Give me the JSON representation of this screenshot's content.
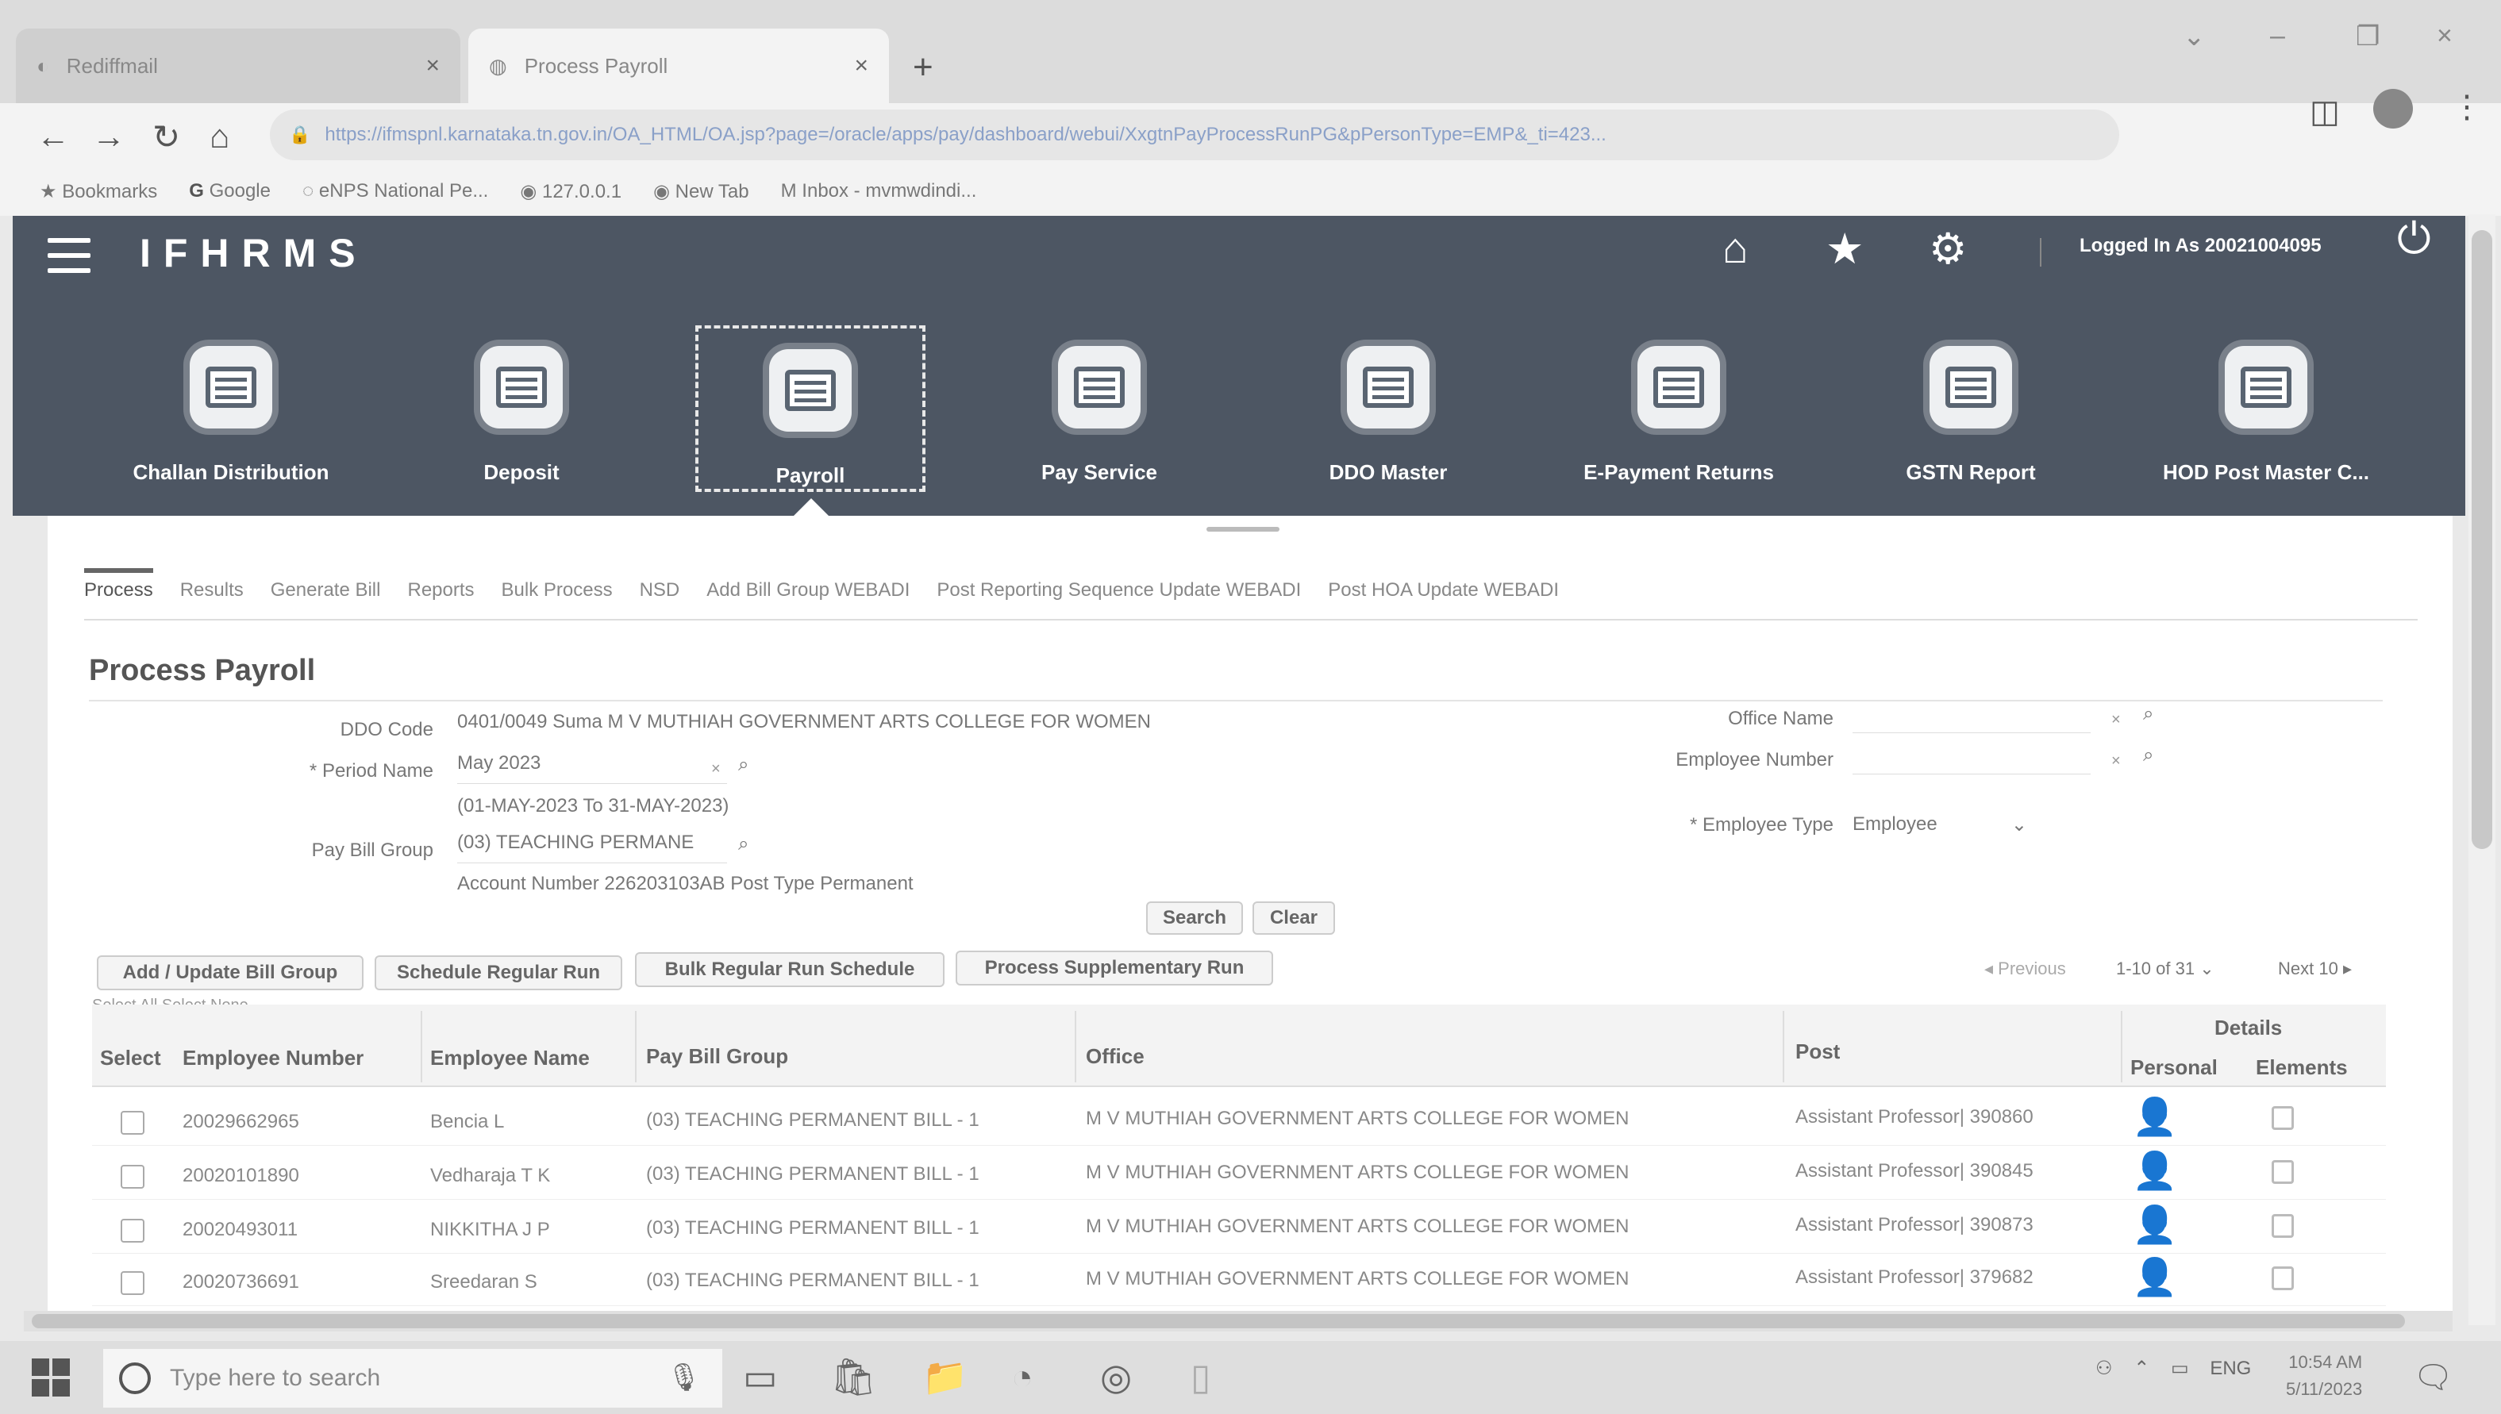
{
  "browser": {
    "tabs": [
      {
        "title": "Rediffmail",
        "active": false
      },
      {
        "title": "Process Payroll",
        "active": true
      }
    ],
    "new_tab_symbol": "+",
    "url": "https://ifmspnl.karnataka.tn.gov.in/OA_HTML/OA.jsp?page=/oracle/apps/pay/dashboard/webui/XxgtnPayProcessRunPG&pPersonType=EMP&_ti=423...",
    "bookmarks": [
      "Bookmarks",
      "Google",
      "eNPS  National Pe...",
      "127.0.0.1",
      "New Tab",
      "Inbox - mvmwdindi..."
    ]
  },
  "app": {
    "logo": "IFHRMS",
    "logged_in": "Logged In As 20021004095",
    "tiles": [
      {
        "label": "Challan Distribution",
        "active": false
      },
      {
        "label": "Deposit",
        "active": false
      },
      {
        "label": "Payroll",
        "active": true
      },
      {
        "label": "Pay Service",
        "active": false
      },
      {
        "label": "DDO Master",
        "active": false
      },
      {
        "label": "E-Payment Returns",
        "active": false
      },
      {
        "label": "GSTN Report",
        "active": false
      },
      {
        "label": "HOD Post Master C...",
        "active": false
      }
    ],
    "subtabs": [
      "Process",
      "Results",
      "Generate Bill",
      "Reports",
      "Bulk Process",
      "NSD",
      "Add Bill Group WEBADI",
      "Post Reporting Sequence Update WEBADI",
      "Post HOA Update WEBADI"
    ]
  },
  "form": {
    "title": "Process Payroll",
    "ddo_code_label": "DDO Code",
    "ddo_code_value": "0401/0049 Suma M V MUTHIAH GOVERNMENT ARTS COLLEGE FOR WOMEN",
    "period_label": "Period Name",
    "period_value": "May 2023",
    "period_range": "(01-MAY-2023 To 31-MAY-2023)",
    "paybill_label": "Pay Bill Group",
    "paybill_value": "(03) TEACHING PERMANE",
    "account_line": "Account Number  226203103AB  Post Type  Permanent",
    "office_label": "Office Name",
    "employee_number_label": "Employee Number",
    "employee_type_label": "Employee Type",
    "employee_type_value": "Employee",
    "search_btn": "Search",
    "clear_btn": "Clear",
    "clear_x": "×",
    "search_symbol": "⌕"
  },
  "actions": {
    "buttons": [
      "Add / Update Bill Group",
      "Schedule Regular Run",
      "Bulk Regular Run Schedule",
      "Process Supplementary Run"
    ],
    "select_all": "Select All  Select None",
    "pager_prev": "Previous",
    "pager_range": "1-10 of 31",
    "pager_next": "Next 10"
  },
  "table": {
    "headers": {
      "select": "Select",
      "emp_no": "Employee Number",
      "emp_name": "Employee Name",
      "paybill": "Pay Bill Group",
      "office": "Office",
      "post": "Post",
      "details": "Details",
      "personal": "Personal",
      "elements": "Elements"
    },
    "rows": [
      {
        "emp_no": "20029662965",
        "name": "Bencia L",
        "paybill": "(03) TEACHING PERMANENT BILL - 1",
        "office": "M V MUTHIAH GOVERNMENT ARTS COLLEGE FOR WOMEN",
        "post": "Assistant Professor| 390860"
      },
      {
        "emp_no": "20020101890",
        "name": "Vedharaja T K",
        "paybill": "(03) TEACHING PERMANENT BILL - 1",
        "office": "M V MUTHIAH GOVERNMENT ARTS COLLEGE FOR WOMEN",
        "post": "Assistant Professor| 390845"
      },
      {
        "emp_no": "20020493011",
        "name": "NIKKITHA J P",
        "paybill": "(03) TEACHING PERMANENT BILL - 1",
        "office": "M V MUTHIAH GOVERNMENT ARTS COLLEGE FOR WOMEN",
        "post": "Assistant Professor| 390873"
      },
      {
        "emp_no": "20020736691",
        "name": "Sreedaran S",
        "paybill": "(03) TEACHING PERMANENT BILL - 1",
        "office": "M V MUTHIAH GOVERNMENT ARTS COLLEGE FOR WOMEN",
        "post": "Assistant Professor| 379682"
      }
    ]
  },
  "taskbar": {
    "search_placeholder": "Type here to search",
    "tray_lang": "ENG",
    "time": "10:54 AM",
    "date": "5/11/2023"
  }
}
